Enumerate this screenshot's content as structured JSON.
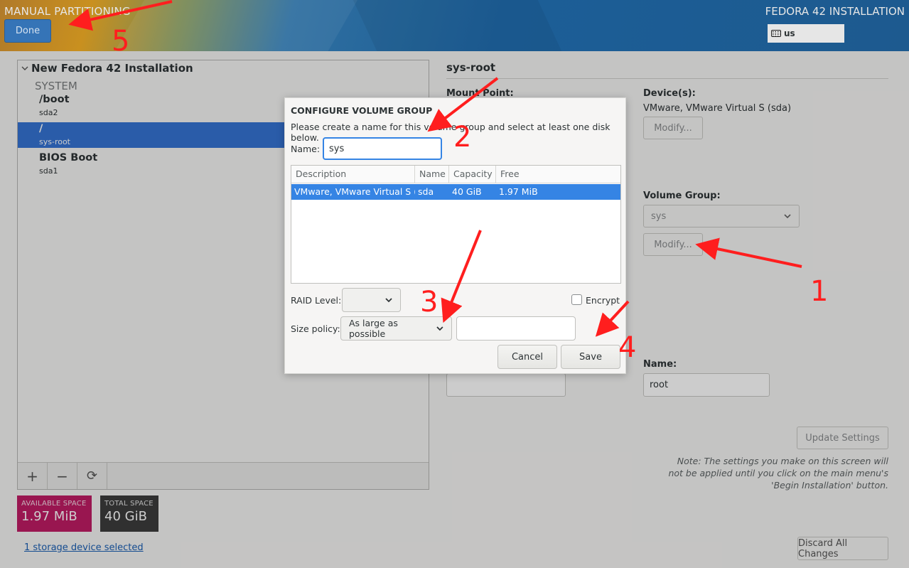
{
  "header": {
    "title": "MANUAL PARTITIONING",
    "done_label": "Done",
    "install_title": "FEDORA 42 INSTALLATION",
    "keyboard_layout": "us"
  },
  "left_pane": {
    "installation_title": "New Fedora 42 Installation",
    "section_label": "SYSTEM",
    "mount_points": [
      {
        "name": "/boot",
        "device": "sda2"
      },
      {
        "name": "/",
        "device": "sys-root"
      },
      {
        "name": "BIOS Boot",
        "device": "sda1"
      }
    ],
    "add_symbol": "+",
    "remove_symbol": "−",
    "refresh_symbol": "⟳"
  },
  "space": {
    "available_label": "AVAILABLE SPACE",
    "available_value": "1.97 MiB",
    "total_label": "TOTAL SPACE",
    "total_value": "40 GiB"
  },
  "storage_link": "1 storage device selected",
  "right_pane": {
    "title": "sys-root",
    "mount_point_label": "Mount Point:",
    "devices_label": "Device(s):",
    "devices_value": "VMware, VMware Virtual S (sda)",
    "modify_label": "Modify...",
    "volume_group_label": "Volume Group:",
    "volume_group_value": "sys",
    "vg_modify_label": "Modify...",
    "name_label": "Name:",
    "name_value": "root",
    "update_label": "Update Settings",
    "note": "Note:  The settings you make on this screen will not be applied until you click on the main menu's 'Begin Installation' button.",
    "discard_label": "Discard All Changes"
  },
  "dialog": {
    "title": "CONFIGURE VOLUME GROUP",
    "description": "Please create a name for this volume group and select at least one disk below.",
    "name_label": "Name:",
    "name_value": "sys",
    "columns": [
      "Description",
      "Name",
      "Capacity",
      "Free"
    ],
    "rows": [
      {
        "description": "VMware, VMware Virtual S ()",
        "name": "sda",
        "capacity": "40 GiB",
        "free": "1.97 MiB"
      }
    ],
    "raid_label": "RAID Level:",
    "raid_value": "",
    "encrypt_label": "Encrypt",
    "size_policy_label": "Size policy:",
    "size_policy_value": "As large as possible",
    "size_value": "",
    "cancel_label": "Cancel",
    "save_label": "Save"
  },
  "annotations": {
    "color": "#ff1e1e",
    "numbers": [
      "1",
      "2",
      "3",
      "4",
      "5"
    ]
  },
  "colors": {
    "selected_row": "#3574d4",
    "available_space": "#c01c64",
    "total_space": "#3d3d3d",
    "done_button": "#3574b7"
  }
}
